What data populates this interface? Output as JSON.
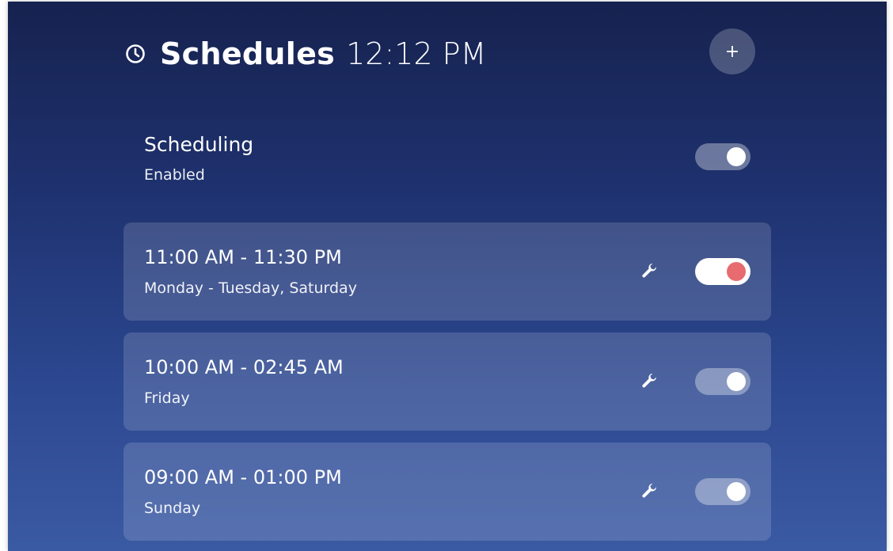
{
  "header": {
    "icon": "clock-icon",
    "title": "Schedules",
    "time": "12:12 PM",
    "add_label": "+"
  },
  "scheduling": {
    "title": "Scheduling",
    "status": "Enabled",
    "toggle_on": false
  },
  "schedules": [
    {
      "time_range": "11:00 AM - 11:30 PM",
      "days": "Monday - Tuesday, Saturday",
      "toggle_on": true,
      "edit_icon": "wrench-icon"
    },
    {
      "time_range": "10:00 AM - 02:45 AM",
      "days": "Friday",
      "toggle_on": false,
      "edit_icon": "wrench-icon"
    },
    {
      "time_range": "09:00 AM - 01:00 PM",
      "days": "Sunday",
      "toggle_on": false,
      "edit_icon": "wrench-icon"
    }
  ],
  "colors": {
    "accent_knob": "#e86b6f",
    "background_top": "#16224f",
    "background_bottom": "#3b5aa4"
  }
}
